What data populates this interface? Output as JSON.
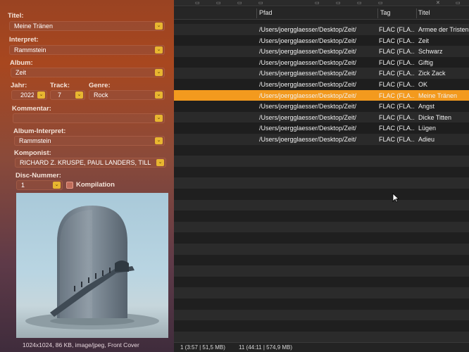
{
  "metadata": {
    "title_label": "Titel:",
    "title_value": "Meine Tränen",
    "artist_label": "Interpret:",
    "artist_value": "Rammstein",
    "album_label": "Album:",
    "album_value": "Zeit",
    "year_label": "Jahr:",
    "year_value": "2022",
    "track_label": "Track:",
    "track_value": "7",
    "genre_label": "Genre:",
    "genre_value": "Rock",
    "comment_label": "Kommentar:",
    "comment_value": "",
    "album_artist_label": "Album-Interpret:",
    "album_artist_value": "Rammstein",
    "composer_label": "Komponist:",
    "composer_value": "RICHARD Z. KRUSPE, PAUL LANDERS, TILL LINDEMANN",
    "disc_label": "Disc-Nummer:",
    "disc_value": "1",
    "compilation_label": "Kompilation",
    "compilation_checked": false,
    "cover_caption": "1024x1024, 86 KB, image/jpeg, Front Cover"
  },
  "table": {
    "columns": [
      "Pfad",
      "Tag",
      "Titel"
    ],
    "selected_index": 5,
    "rows": [
      {
        "path": "/Users/joergglaesser/Desktop/Zeit/",
        "tag": "FLAC (FLA...",
        "title": "Armee der Tristen"
      },
      {
        "path": "/Users/joergglaesser/Desktop/Zeit/",
        "tag": "FLAC (FLA...",
        "title": "Zeit"
      },
      {
        "path": "/Users/joergglaesser/Desktop/Zeit/",
        "tag": "FLAC (FLA...",
        "title": "Schwarz"
      },
      {
        "path": "/Users/joergglaesser/Desktop/Zeit/",
        "tag": "FLAC (FLA...",
        "title": "Giftig"
      },
      {
        "path": "/Users/joergglaesser/Desktop/Zeit/",
        "tag": "FLAC (FLA...",
        "title": "Zick Zack"
      },
      {
        "path": "/Users/joergglaesser/Desktop/Zeit/",
        "tag": "FLAC (FLA...",
        "title": "OK"
      },
      {
        "path": "/Users/joergglaesser/Desktop/Zeit/",
        "tag": "FLAC (FLA...",
        "title": "Meine Tränen"
      },
      {
        "path": "/Users/joergglaesser/Desktop/Zeit/",
        "tag": "FLAC (FLA...",
        "title": "Angst"
      },
      {
        "path": "/Users/joergglaesser/Desktop/Zeit/",
        "tag": "FLAC (FLA...",
        "title": "Dicke Titten"
      },
      {
        "path": "/Users/joergglaesser/Desktop/Zeit/",
        "tag": "FLAC (FLA...",
        "title": "Lügen"
      },
      {
        "path": "/Users/joergglaesser/Desktop/Zeit/",
        "tag": "FLAC (FLA...",
        "title": "Adieu"
      }
    ]
  },
  "status": {
    "selection": "1 (3:57 | 51,5 MB)",
    "total": "11 (44:11 | 574,9 MB)"
  },
  "colors": {
    "selected_row": "#f39a1e",
    "popup_chevron": "#e8b630"
  },
  "icons": {
    "popup_chevron": "⌄",
    "cursor": "mouse-pointer-icon"
  }
}
